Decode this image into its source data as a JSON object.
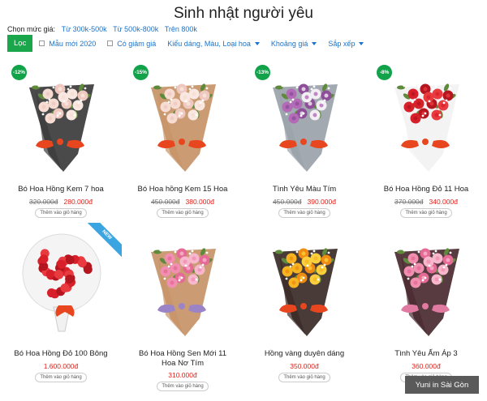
{
  "page": {
    "title": "Sinh nhật người yêu"
  },
  "price_filter": {
    "label": "Chọn mức giá:",
    "links": [
      "Từ 300k-500k",
      "Từ 500k-800k",
      "Trên 800k"
    ]
  },
  "filters": {
    "submit_label": "Lọc",
    "checkboxes": [
      "Mẫu mới 2020",
      "Có giảm giá"
    ],
    "dropdowns": [
      "Kiểu dáng, Màu, Loại hoa",
      "Khoảng giá",
      "Sắp xếp"
    ]
  },
  "cart_label": "Thêm vào giỏ hàng",
  "products": [
    {
      "name": "Bó Hoa Hồng Kem 7 hoa",
      "old_price": "320.000đ",
      "price": "280.000đ",
      "discount": "-12%",
      "flower": "cream",
      "wrap": "#3b3b3b"
    },
    {
      "name": "Bó Hoa hồng Kem 15 Hoa",
      "old_price": "450.000đ",
      "price": "380.000đ",
      "discount": "-15%",
      "flower": "cream",
      "wrap": "#c79468"
    },
    {
      "name": "Tình Yêu Màu Tím",
      "old_price": "450.000đ",
      "price": "390.000đ",
      "discount": "-13%",
      "flower": "purple",
      "wrap": "#9aa2aa"
    },
    {
      "name": "Bó Hoa Hồng Đỏ 11 Hoa",
      "old_price": "370.000đ",
      "price": "340.000đ",
      "discount": "-8%",
      "flower": "red",
      "wrap": "#f2f2f2"
    },
    {
      "name": "Bó Hoa Hồng Đỏ 100 Bông",
      "old_price": "",
      "price": "1.600.000đ",
      "discount": "",
      "ribbon": "NEW",
      "flower": "red",
      "wrap": "#eeeeee"
    },
    {
      "name": "Bó Hoa Hồng Sen Mới 11 Hoa Nơ Tím",
      "old_price": "",
      "price": "310.000đ",
      "discount": "",
      "flower": "pink",
      "wrap": "#c79468"
    },
    {
      "name": "Hồng vàng duyên dáng",
      "old_price": "",
      "price": "350.000đ",
      "discount": "",
      "flower": "yellow",
      "wrap": "#3a2a26"
    },
    {
      "name": "Tình Yêu Ấm Áp 3",
      "old_price": "",
      "price": "360.000đ",
      "discount": "",
      "flower": "pink",
      "wrap": "#4a2a30"
    }
  ],
  "footer_tag": "Yuni in Sài Gòn"
}
